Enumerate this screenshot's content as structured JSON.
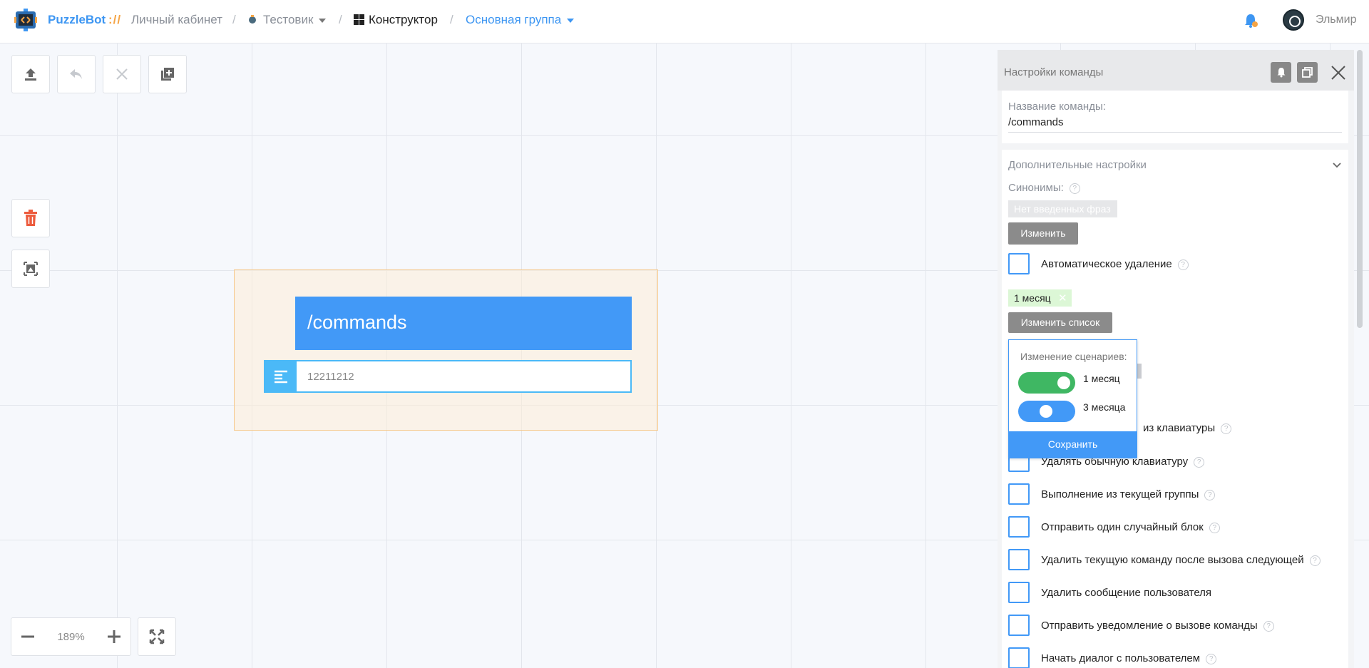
{
  "header": {
    "brand": "PuzzleBot",
    "brand_sep": "://",
    "cabinet": "Личный кабинет",
    "bot_name": "Тестовик",
    "constructor": "Конструктор",
    "group": "Основная группа",
    "username": "Эльмир"
  },
  "canvas": {
    "zoom": "189%",
    "block": {
      "title": "/commands",
      "row_text": "12211212"
    }
  },
  "panel": {
    "title": "Настройки команды",
    "name_label": "Название команды:",
    "name_value": "/commands",
    "extra_label": "Дополнительные настройки",
    "synonyms_label": "Синонимы:",
    "no_phrases": "Нет введенных фраз",
    "change_button": "Изменить",
    "auto_delete_label": "Автоматическое удаление",
    "period_tag": "1 месяц",
    "change_list_button": "Изменить список",
    "checkbox_partial": "из клавиатуры",
    "options": [
      "Удалять обычную клавиатуру",
      "Выполнение из текущей группы",
      "Отправить один случайный блок",
      "Удалить текущую команду после вызова следующей",
      "Удалить сообщение пользователя",
      "Отправить уведомление о вызове команды",
      "Начать диалог с пользователем"
    ]
  },
  "popup": {
    "title": "Изменение сценариев:",
    "toggles": [
      {
        "label": "1 месяц",
        "on": true,
        "color": "#3fb763"
      },
      {
        "label": "3 месяца",
        "on": false,
        "color": "#4299f7"
      }
    ],
    "save": "Сохранить"
  }
}
